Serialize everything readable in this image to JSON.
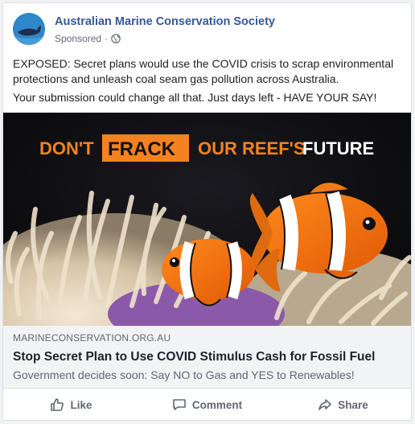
{
  "post": {
    "page_name": "Australian Marine Conservation Society",
    "sponsored_label": "Sponsored",
    "separator": "·",
    "text_lines": [
      "EXPOSED: Secret plans would use the COVID crisis to scrap environmental protections and unleash coal seam gas pollution across Australia.",
      "Your submission could change all that. Just days left - HAVE YOUR SAY!"
    ]
  },
  "ad_image": {
    "headline_part1": "DON'T",
    "headline_highlight": "FRACK",
    "headline_part2": "OUR REEF'S",
    "headline_part3": "FUTURE",
    "highlight_color": "#f58220",
    "accent_color": "#f58220"
  },
  "link": {
    "domain": "MARINECONSERVATION.ORG.AU",
    "title": "Stop Secret Plan to Use COVID Stimulus Cash for Fossil Fuel",
    "description": "Government decides soon: Say NO to Gas and YES to Renewables!"
  },
  "actions": {
    "like_label": "Like",
    "comment_label": "Comment",
    "share_label": "Share"
  },
  "colors": {
    "page_name": "#385898",
    "muted_text": "#606770"
  }
}
